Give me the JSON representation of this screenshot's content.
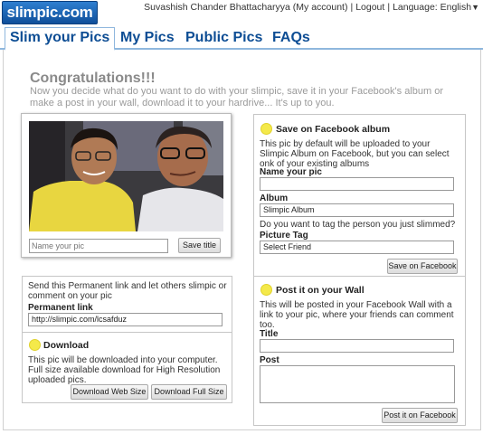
{
  "app": {
    "logo_text": "slimpic.com"
  },
  "top_links": {
    "user": "Suvashish Chander Bhattacharyya",
    "my_account": "(My account)",
    "logout": "Logout",
    "language_label": "Language:",
    "language_value": "English"
  },
  "nav": {
    "tabs": [
      {
        "label": "Slim your Pics"
      },
      {
        "label": "My Pics"
      },
      {
        "label": "Public Pics"
      },
      {
        "label": "FAQs"
      }
    ]
  },
  "main": {
    "title": "Congratulations!!!",
    "intro": "Now you decide what do you want to do with your slimpic, save it in your Facebook's album or make a post in your wall, download it to your hardrive... It's up to you."
  },
  "photo_card": {
    "caption_placeholder": "Name your pic",
    "save_title_label": "Save title"
  },
  "link_panel": {
    "description": "Send this Permanent link and let others slimpic or comment on your pic",
    "permanent_link_label": "Permanent link",
    "permanent_link_value": "http://slimpic.com/lcsafduz",
    "download_heading": "Download",
    "download_description": "This pic will be downloaded into your computer. Full size available download for High Resolution uploaded pics.",
    "download_web_label": "Download Web Size",
    "download_full_label": "Download Full Size"
  },
  "facebook_panel": {
    "album_heading": "Save on Facebook album",
    "album_description": "This pic by default will be uploaded to your Slimpic Album on Facebook, but you can select onk of your existing albums",
    "name_label": "Name your pic",
    "name_value": "",
    "album_label": "Album",
    "album_value": "Slimpic Album",
    "tag_question": "Do you want to tag the person you just slimmed?",
    "picture_tag_label": "Picture Tag",
    "picture_tag_value": "Select Friend",
    "save_fb_label": "Save on Facebook",
    "wall_heading": "Post it on your Wall",
    "wall_description": "This will be posted in your Facebook Wall with a link to your pic, where your friends can comment too.",
    "title_label": "Title",
    "post_label": "Post",
    "post_fb_label": "Post it on Facebook"
  },
  "colors": {
    "nav_text": "#0d4d94",
    "nav_border": "#8fb7dd",
    "bullet": "#f4e94a",
    "logo_bg": "#1a62b4"
  },
  "icons": [
    "language-dropdown-arrow-icon",
    "bullet-dot-icon"
  ]
}
